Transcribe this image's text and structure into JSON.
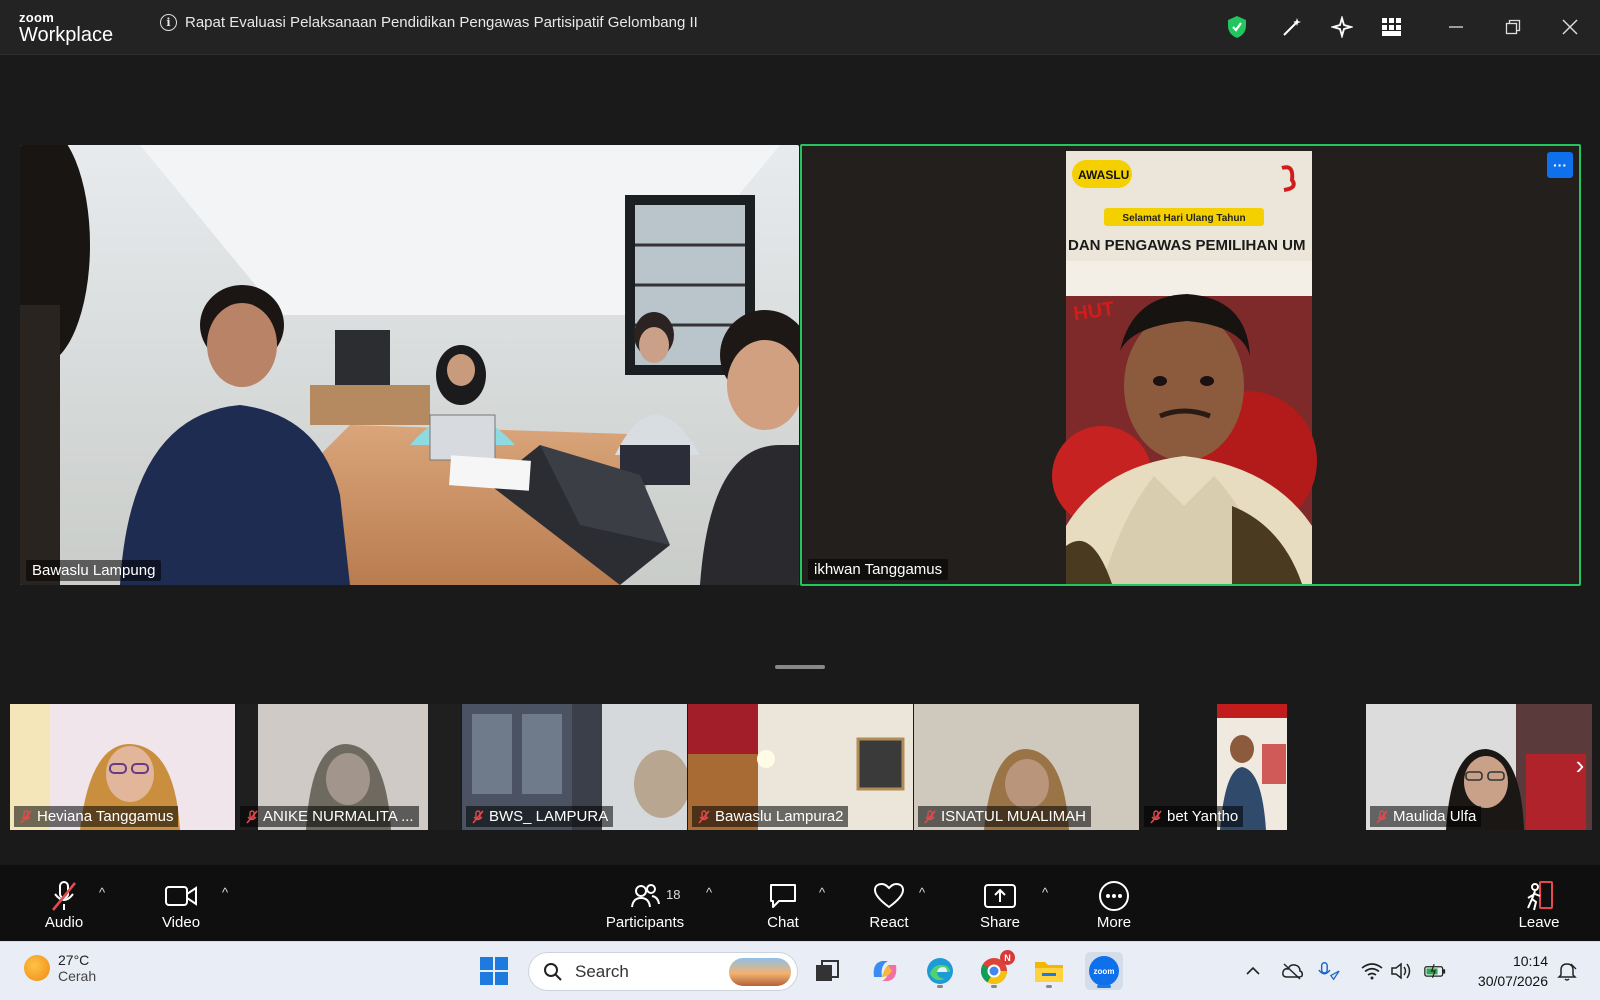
{
  "app": {
    "logo_top": "zoom",
    "logo_bottom": "Workplace",
    "meeting_title": "Rapat Evaluasi Pelaksanaan Pendidikan Pengawas Partisipatif Gelombang II"
  },
  "stage": {
    "tiles": [
      {
        "name": "Bawaslu Lampung"
      },
      {
        "name": "ikhwan Tanggamus",
        "active_speaker": true,
        "more_label": "···"
      }
    ],
    "banner_text": {
      "org": "AWASLU",
      "greeting": "Selamat Hari Ulang Tahun",
      "line": "DAN PENGAWAS PEMILIHAN UM",
      "hut": "HUT"
    }
  },
  "filmstrip": [
    {
      "name": "Heviana Tanggamus",
      "muted": true
    },
    {
      "name": "ANIKE NURMALITA ...",
      "muted": true
    },
    {
      "name": "BWS_ LAMPURA",
      "muted": true
    },
    {
      "name": "Bawaslu Lampura2",
      "muted": true
    },
    {
      "name": "ISNATUL MUALIMAH",
      "muted": true
    },
    {
      "name": "bet Yantho",
      "muted": true
    },
    {
      "name": "Maulida Ulfa",
      "muted": true
    }
  ],
  "toolbar": {
    "audio": "Audio",
    "video": "Video",
    "participants": "Participants",
    "participants_count": "18",
    "chat": "Chat",
    "react": "React",
    "share": "Share",
    "more": "More",
    "leave": "Leave",
    "caret": "^"
  },
  "taskbar": {
    "temperature": "27°C",
    "weather": "Cerah",
    "search_placeholder": "Search",
    "time": "10:14",
    "date": "30/07/2026",
    "chrome_badge": "N",
    "zoom_label": "zoom"
  },
  "colors": {
    "active_border": "#22c55e",
    "zoom_blue": "#0e71eb",
    "muted_red": "#e5484d"
  }
}
